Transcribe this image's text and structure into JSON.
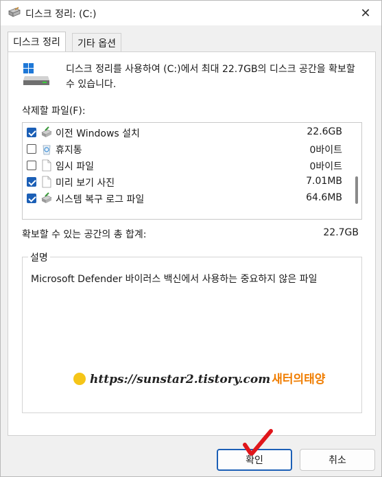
{
  "window": {
    "title": "디스크 정리: (C:)",
    "close_glyph": "✕"
  },
  "tabs": [
    {
      "label": "디스크 정리",
      "active": true
    },
    {
      "label": "기타 옵션",
      "active": false
    }
  ],
  "description": "디스크 정리를 사용하여 (C:)에서 최대 22.7GB의 디스크 공간을 확보할 수 있습니다.",
  "files_label": "삭제할 파일(F):",
  "files": [
    {
      "name": "이전 Windows 설치",
      "size": "22.6GB",
      "checked": true,
      "icon": "cleanup-icon"
    },
    {
      "name": "휴지통",
      "size": "0바이트",
      "checked": false,
      "icon": "recycle-bin-icon"
    },
    {
      "name": "임시 파일",
      "size": "0바이트",
      "checked": false,
      "icon": "file-icon"
    },
    {
      "name": "미리 보기 사진",
      "size": "7.01MB",
      "checked": true,
      "icon": "file-icon"
    },
    {
      "name": "시스템 복구 로그 파일",
      "size": "64.6MB",
      "checked": true,
      "icon": "cleanup-icon"
    }
  ],
  "total": {
    "label": "확보할 수 있는 공간의 총 합계:",
    "value": "22.7GB"
  },
  "details": {
    "title": "설명",
    "text": "Microsoft Defender 바이러스 백신에서 사용하는 중요하지 않은 파일"
  },
  "watermark": {
    "url": "https://sunstar2.tistory.com",
    "name": "새터의태양"
  },
  "buttons": {
    "ok": "확인",
    "cancel": "취소"
  },
  "colors": {
    "accent": "#1b5fb6",
    "annotation": "#e0161b"
  }
}
